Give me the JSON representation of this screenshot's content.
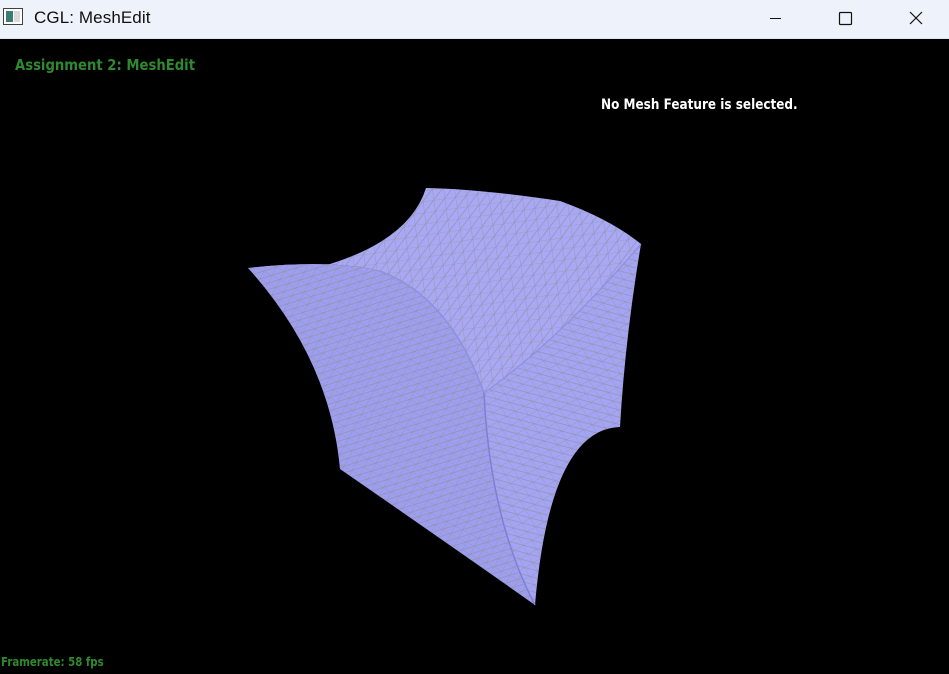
{
  "window": {
    "title": "CGL: MeshEdit",
    "icon": "app-icon",
    "controls": {
      "minimize_icon": "minimize-icon",
      "maximize_icon": "maximize-icon",
      "close_icon": "close-icon"
    }
  },
  "viewport": {
    "assignment_title": "Assignment 2: MeshEdit",
    "selection_status": "No Mesh Feature is selected.",
    "framerate": "Framerate: 58 fps",
    "background_color": "#000000",
    "mesh_fill_color": "#a6a6f6",
    "mesh_wire_color": "#8a8a8a",
    "overlay_text_color": "#2f8a2f"
  }
}
